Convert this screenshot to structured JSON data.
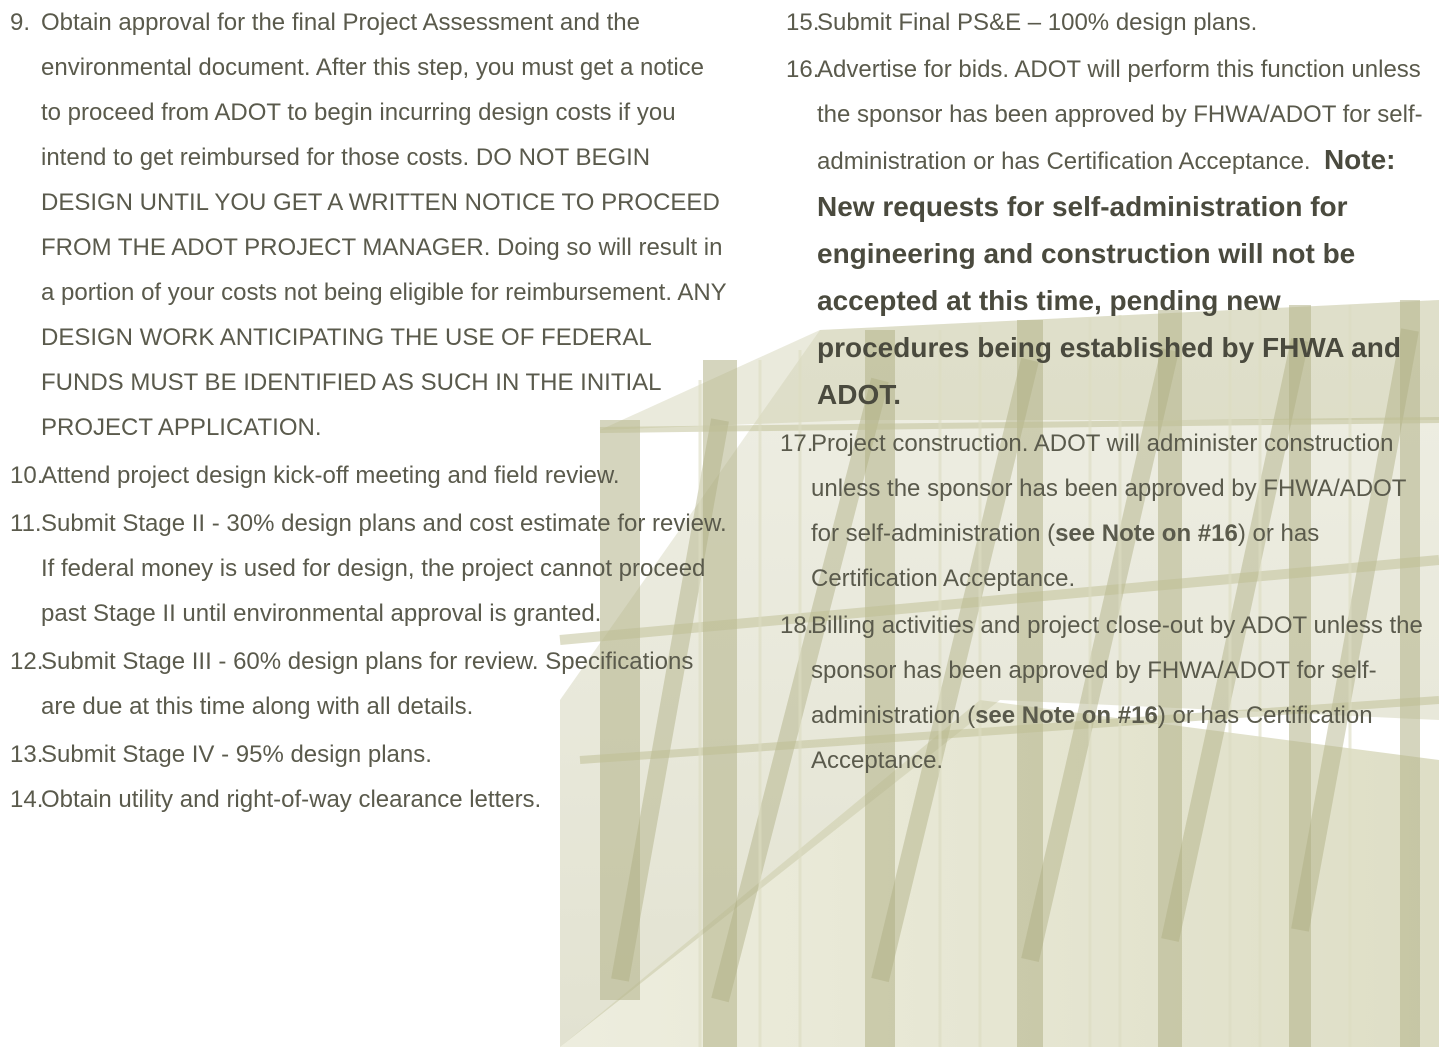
{
  "left_items": [
    {
      "number": "9.",
      "text": "Obtain approval for the final Project Assessment and the environmental document. After this step, you must get a notice to proceed from ADOT to begin incurring design costs if you intend to get reimbursed for those costs. DO NOT BEGIN DESIGN UNTIL YOU GET A WRITTEN NOTICE TO PROCEED FROM THE ADOT PROJECT MANAGER. Doing so will result in a portion of your costs not being eligible for reimbursement. ANY DESIGN WORK ANTICIPATING THE USE OF FEDERAL FUNDS MUST BE IDENTIFIED AS SUCH IN THE INITIAL PROJECT APPLICATION."
    },
    {
      "number": "10.",
      "text": "Attend project design kick-off meeting and field review."
    },
    {
      "number": "11.",
      "text": "Submit Stage II - 30% design plans and cost estimate for review.  If federal money is used for design, the project cannot proceed past Stage II until environmental approval is granted."
    },
    {
      "number": "12.",
      "text": "Submit Stage III - 60% design plans for review. Specifications are due at this time along with all details."
    },
    {
      "number": "13.",
      "text": "Submit Stage IV - 95% design plans."
    },
    {
      "number": "14.",
      "text": "Obtain utility and right-of-way clearance letters."
    }
  ],
  "right_items": {
    "item15": {
      "number": "15.",
      "text": "Submit Final PS&E – 100% design plans."
    },
    "item16": {
      "number": "16.",
      "text": "Advertise for bids. ADOT will perform this function unless the sponsor has been approved by FHWA/ADOT for self-administration or has Certification Acceptance.",
      "note": "Note: New requests for self-administration for engineering and construction will not be accepted at this time, pending new procedures being established by FHWA and ADOT."
    },
    "item17": {
      "number": "17.",
      "text_before": "Project construction.  ADOT will administer construction unless the sponsor has been approved by FHWA/ADOT for self-administration (",
      "bold": "see Note on #16",
      "text_after": ") or has Certification Acceptance."
    },
    "item18": {
      "number": "18.",
      "text_before": " Billing activities and project close-out by ADOT unless the sponsor has been approved by FHWA/ADOT for self-administration (",
      "bold": "see Note on #16",
      "text_after": ") or has Certification Acceptance."
    }
  },
  "colors": {
    "text": "#5a5a4c",
    "photo_tint": "#c8c8a4"
  }
}
